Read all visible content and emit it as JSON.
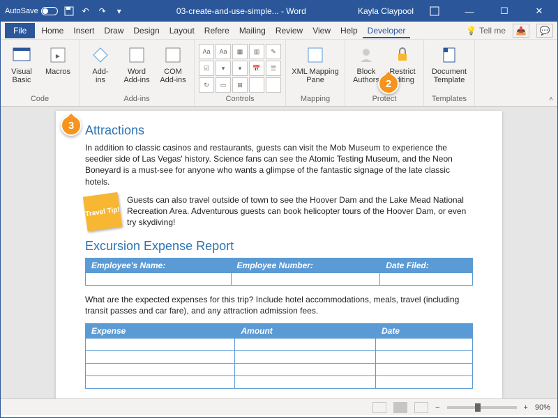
{
  "titlebar": {
    "autosave": "AutoSave",
    "title": "03-create-and-use-simple... - Word",
    "user": "Kayla Claypool"
  },
  "menubar": {
    "tabs": [
      "File",
      "Home",
      "Insert",
      "Draw",
      "Design",
      "Layout",
      "Refere",
      "Mailing",
      "Review",
      "View",
      "Help",
      "Developer"
    ],
    "active_index": 11,
    "tellme": "Tell me"
  },
  "ribbon": {
    "groups": {
      "code": {
        "label": "Code",
        "visual_basic": "Visual\nBasic",
        "macros": "Macros"
      },
      "addins": {
        "label": "Add-ins",
        "addins": "Add-\nins",
        "word_addins": "Word\nAdd-ins",
        "com_addins": "COM\nAdd-ins"
      },
      "controls": {
        "label": "Controls"
      },
      "mapping": {
        "label": "Mapping",
        "xml_pane": "XML Mapping\nPane"
      },
      "protect": {
        "label": "Protect",
        "block_authors": "Block\nAuthors",
        "restrict": "Restrict\nEditing"
      },
      "templates": {
        "label": "Templates",
        "doc_template": "Document\nTemplate"
      }
    }
  },
  "document": {
    "h_attractions": "Attractions",
    "p1": "In addition to classic casinos and restaurants, guests can visit the Mob Museum to experience the seedier side of Las Vegas' history. Science fans can see the Atomic Testing Museum, and the Neon Boneyard is a must-see for anyone who wants a glimpse of the fantastic signage of the late classic hotels.",
    "tip_label": "Travel Tip!",
    "p2": "Guests can also travel outside of town to see the Hoover Dam and the Lake Mead National Recreation Area. Adventurous guests can book helicopter tours of the Hoover Dam, or even try skydiving!",
    "h_report": "Excursion Expense Report",
    "table1_headers": [
      "Employee's Name:",
      "Employee Number:",
      "Date Filed:"
    ],
    "p3": "What are the expected expenses for this trip? Include hotel accommodations, meals, travel (including transit passes and car fare), and any attraction admission fees.",
    "table2_headers": [
      "Expense",
      "Amount",
      "Date"
    ]
  },
  "statusbar": {
    "zoom": "90%"
  },
  "callouts": {
    "two": "2",
    "three": "3"
  }
}
